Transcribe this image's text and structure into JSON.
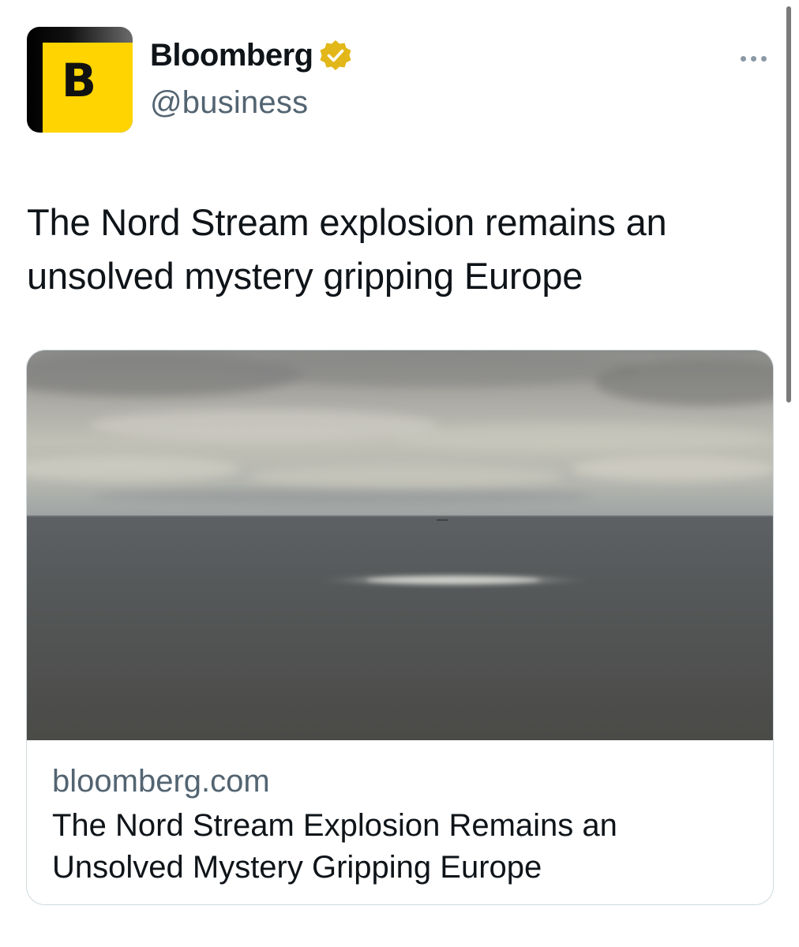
{
  "tweet": {
    "author": {
      "display_name": "Bloomberg",
      "handle": "@business",
      "avatar_letter": "B",
      "verified": true
    },
    "text": "The Nord Stream explosion remains an unsolved mystery gripping Europe",
    "card": {
      "domain": "bloomberg.com",
      "title": "The Nord Stream Explosion Remains an Unsolved Mystery Gripping Europe"
    }
  },
  "icons": {
    "more": "more-horizontal-icon",
    "verified": "verified-badge-icon"
  },
  "colors": {
    "avatar_yellow": "#ffd400",
    "verified_gold": "#e2b719",
    "handle_gray": "#536471",
    "border": "#cfd9de"
  }
}
